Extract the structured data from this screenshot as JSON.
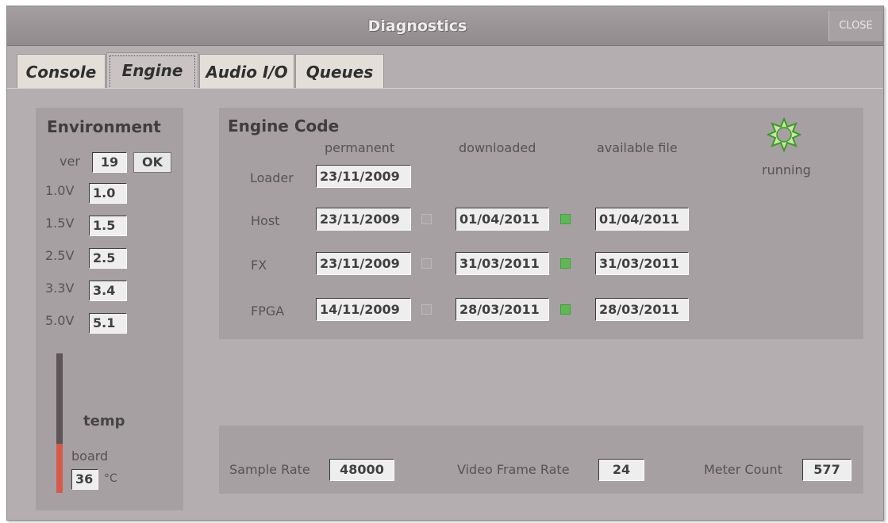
{
  "window": {
    "title": "Diagnostics",
    "close_label": "CLOSE"
  },
  "tabs": [
    {
      "label": "Console",
      "active": false
    },
    {
      "label": "Engine",
      "active": true
    },
    {
      "label": "Audio I/O",
      "active": false
    },
    {
      "label": "Queues",
      "active": false
    }
  ],
  "environment": {
    "title": "Environment",
    "ver_label": "ver",
    "ver_value": "19",
    "ok_label": "OK",
    "voltages": [
      {
        "label": "1.0V",
        "value": "1.0"
      },
      {
        "label": "1.5V",
        "value": "1.5"
      },
      {
        "label": "2.5V",
        "value": "2.5"
      },
      {
        "label": "3.3V",
        "value": "3.4"
      },
      {
        "label": "5.0V",
        "value": "5.1"
      }
    ],
    "temp_title": "temp",
    "board_label": "board",
    "board_temp": "36",
    "temp_unit": "°C",
    "temp_level_fraction": 0.35,
    "temp_fill_color": "#d65a4c"
  },
  "engine_code": {
    "title": "Engine Code",
    "columns": [
      "permanent",
      "downloaded",
      "available file"
    ],
    "status_label": "running",
    "status_icon": "sun-icon",
    "loader": {
      "label": "Loader",
      "permanent": "23/11/2009"
    },
    "rows": [
      {
        "label": "Host",
        "permanent": "23/11/2009",
        "permanent_led": "off",
        "downloaded": "01/04/2011",
        "downloaded_led": "on",
        "available": "01/04/2011"
      },
      {
        "label": "FX",
        "permanent": "23/11/2009",
        "permanent_led": "off",
        "downloaded": "31/03/2011",
        "downloaded_led": "on",
        "available": "31/03/2011"
      },
      {
        "label": "FPGA",
        "permanent": "14/11/2009",
        "permanent_led": "off",
        "downloaded": "28/03/2011",
        "downloaded_led": "on",
        "available": "28/03/2011"
      }
    ],
    "led_on_color": "#5cba53"
  },
  "footer": {
    "sample_rate_label": "Sample Rate",
    "sample_rate": "48000",
    "video_frame_rate_label": "Video Frame Rate",
    "video_frame_rate": "24",
    "meter_count_label": "Meter Count",
    "meter_count": "577"
  }
}
